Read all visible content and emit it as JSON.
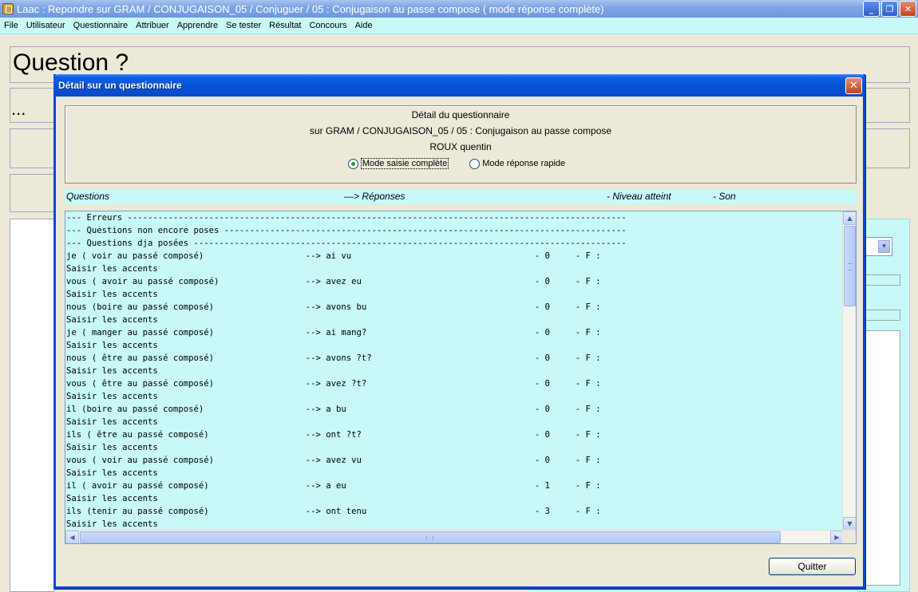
{
  "window": {
    "title": "Laac : Repondre sur GRAM / CONJUGAISON_05 / Conjuguer / 05 : Conjugaison au passe compose ( mode réponse complète)",
    "controls": {
      "minimize": "_",
      "restore": "❐",
      "close": "✕"
    }
  },
  "menu": [
    "File",
    "Utilisateur",
    "Questionnaire",
    "Attribuer",
    "Apprendre",
    "Se tester",
    "Résultat",
    "Concours",
    "Aide"
  ],
  "background": {
    "question_heading": "Question ?",
    "ellipsis": "...",
    "ellipsis_right": "..."
  },
  "dialog": {
    "title": "Détail sur un questionnaire",
    "close_glyph": "✕",
    "detail": {
      "line1": "Détail du questionnaire",
      "line2": "sur GRAM / CONJUGAISON_05 / 05 : Conjugaison au passe compose",
      "line3": "ROUX quentin"
    },
    "modes": [
      {
        "label": "Mode saisie complète",
        "checked": true
      },
      {
        "label": "Mode réponse rapide",
        "checked": false
      }
    ],
    "columns": {
      "questions": "Questions",
      "reponses": "—> Réponses",
      "niveau": "-  Niveau atteint",
      "son": "-  Son"
    },
    "text_lines": [
      "--- Erreurs --------------------------------------------------------------------------------------------------",
      "--- Questions non encore poses -------------------------------------------------------------------------------",
      "--- Questions dja posées -------------------------------------------------------------------------------------",
      "je ( voir au passé composé)                    --> ai vu                                    - 0     - F :",
      "Saisir les accents",
      "vous ( avoir au passé composé)                 --> avez eu                                  - 0     - F :",
      "Saisir les accents",
      "nous (boire au passé composé)                  --> avons bu                                 - 0     - F :",
      "Saisir les accents",
      "je ( manger au passé composé)                  --> ai mang?                                 - 0     - F :",
      "Saisir les accents",
      "nous ( être au passé composé)                  --> avons ?t?                                - 0     - F :",
      "Saisir les accents",
      "vous ( être au passé composé)                  --> avez ?t?                                 - 0     - F :",
      "Saisir les accents",
      "il (boire au passé composé)                    --> a bu                                     - 0     - F :",
      "Saisir les accents",
      "ils ( être au passé composé)                   --> ont ?t?                                  - 0     - F :",
      "Saisir les accents",
      "vous ( voir au passé composé)                  --> avez vu                                  - 0     - F :",
      "Saisir les accents",
      "il ( avoir au passé composé)                   --> a eu                                     - 1     - F :",
      "Saisir les accents",
      "ils (tenir au passé composé)                   --> ont tenu                                 - 3     - F :",
      "Saisir les accents"
    ],
    "scroll": {
      "vertical_position": 0.0,
      "horizontal_position": 0.0,
      "up": "▲",
      "down": "▼",
      "left": "◀",
      "right": "▶"
    },
    "quit_label": "Quitter"
  },
  "right_select_glyph": "▾"
}
